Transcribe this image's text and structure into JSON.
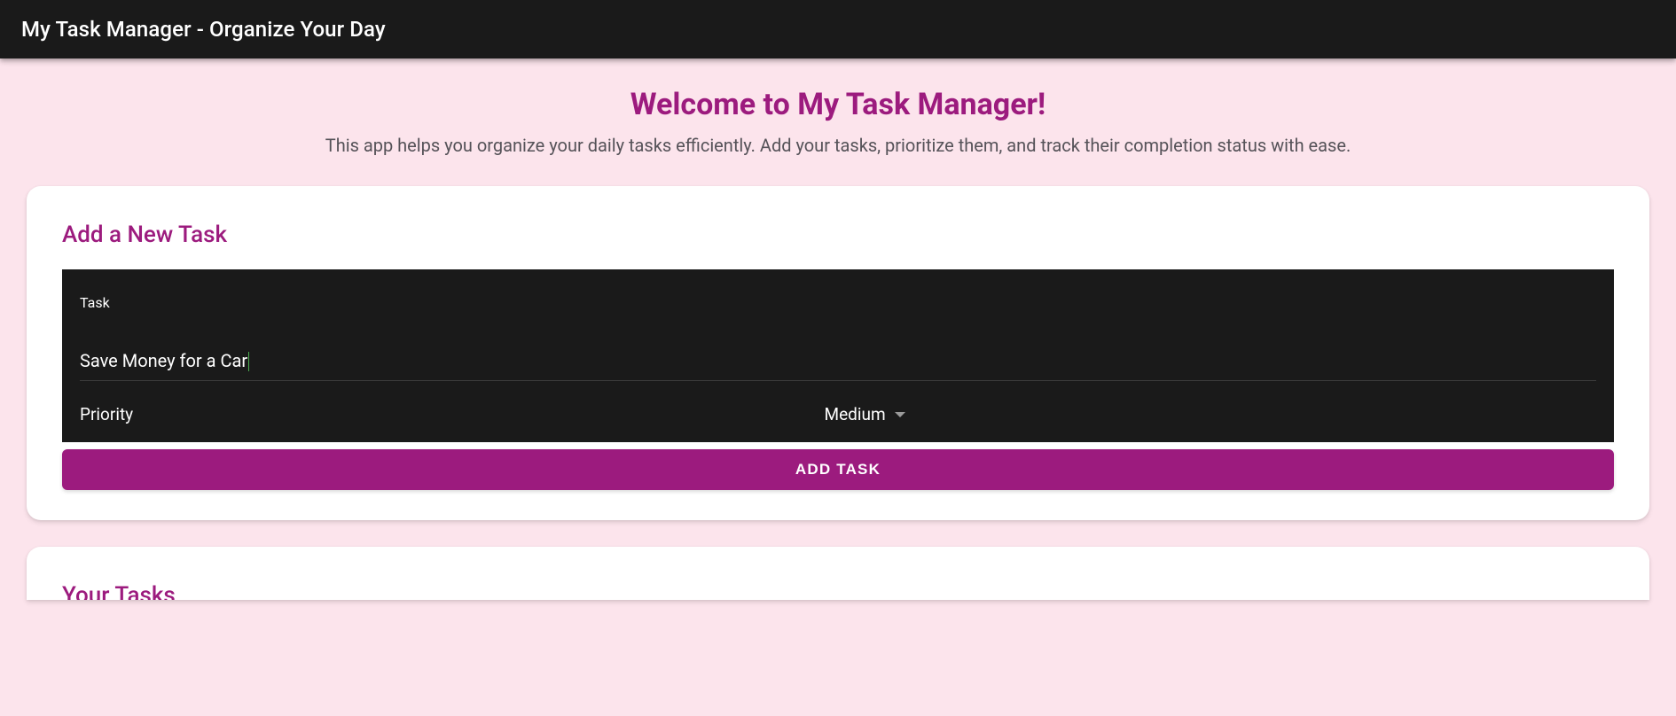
{
  "header": {
    "title": "My Task Manager - Organize Your Day"
  },
  "welcome": {
    "heading": "Welcome to My Task Manager!",
    "subtext": "This app helps you organize your daily tasks efficiently. Add your tasks, prioritize them, and track their completion status with ease."
  },
  "addTaskCard": {
    "title": "Add a New Task",
    "taskField": {
      "label": "Task",
      "value": "Save Money for a Car"
    },
    "priorityField": {
      "label": "Priority",
      "value": "Medium"
    },
    "buttonLabel": "ADD TASK"
  },
  "tasksCard": {
    "title": "Your Tasks"
  }
}
